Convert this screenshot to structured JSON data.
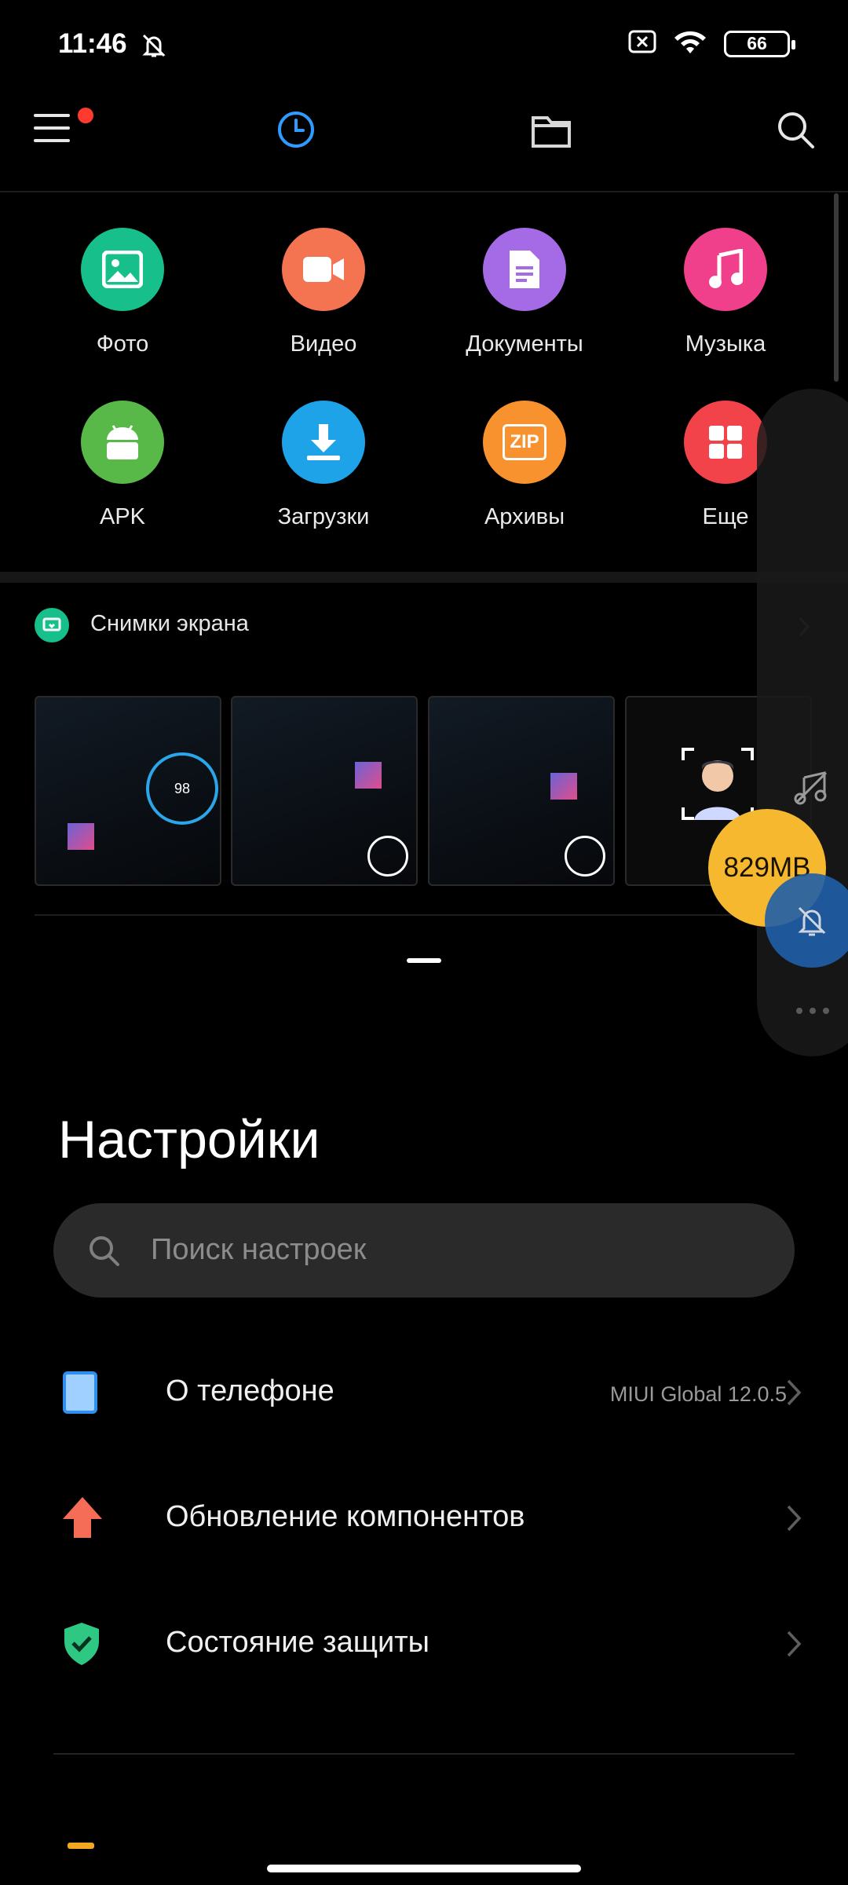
{
  "status_bar": {
    "time": "11:46",
    "battery": "66"
  },
  "file_manager": {
    "toolbar_icons": [
      "menu-icon",
      "recent-clock-icon",
      "folder-icon",
      "search-icon"
    ],
    "categories": [
      {
        "label": "Фото",
        "color": "#17c08a",
        "icon": "photo-icon"
      },
      {
        "label": "Видео",
        "color": "#f47351",
        "icon": "video-icon"
      },
      {
        "label": "Документы",
        "color": "#a56ae6",
        "icon": "document-icon"
      },
      {
        "label": "Музыка",
        "color": "#f0408b",
        "icon": "music-icon"
      },
      {
        "label": "APK",
        "color": "#58b949",
        "icon": "android-icon"
      },
      {
        "label": "Загрузки",
        "color": "#1ea2e8",
        "icon": "download-icon"
      },
      {
        "label": "Архивы",
        "color": "#f7922f",
        "icon": "zip-icon"
      },
      {
        "label": "Еще",
        "color": "#f2434a",
        "icon": "grid-icon"
      }
    ],
    "zip_badge": "ZIP",
    "recent_section": {
      "title": "Снимки экрана"
    },
    "thumbnail_value": "98"
  },
  "overlay": {
    "memory": "829MB"
  },
  "settings": {
    "title": "Настройки",
    "search_placeholder": "Поиск настроек",
    "rows": [
      {
        "label": "О телефоне",
        "value": "MIUI Global 12.0.5",
        "icon": "phone-icon"
      },
      {
        "label": "Обновление компонентов",
        "value": "",
        "icon": "update-arrow-icon"
      },
      {
        "label": "Состояние защиты",
        "value": "",
        "icon": "shield-check-icon"
      }
    ]
  },
  "colors": {
    "accent": "#2f9bff",
    "background": "#000000"
  }
}
